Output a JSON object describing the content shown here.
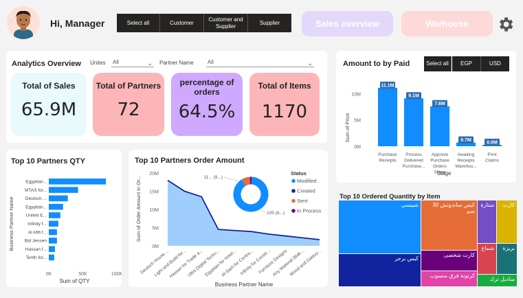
{
  "header": {
    "greeting": "Hi, Manager",
    "segments": [
      "Select all",
      "Customer",
      "Customer and Supplier",
      "Supplier"
    ],
    "nav_sales": "Sales overview",
    "nav_warehouse": "Warhouse"
  },
  "analytics": {
    "title": "Analytics Overview",
    "unites_label": "Unites",
    "unites_value": "All",
    "partner_label": "Partner Name",
    "partner_value": "All",
    "kpis": [
      {
        "label": "Total of Sales",
        "value": "65.9M",
        "color": "#e8fafb"
      },
      {
        "label": "Total of Partners",
        "value": "72",
        "color": "#fdb6b8"
      },
      {
        "label": "percentage of orders",
        "value": "64.5%",
        "color": "#cfa9ff"
      },
      {
        "label": "Total of Items",
        "value": "1170",
        "color": "#fdb6b8"
      }
    ]
  },
  "paid": {
    "title": "Amount to by Paid",
    "buttons": [
      "Select all",
      "EGP",
      "USD"
    ],
    "chart_data": {
      "type": "bar",
      "categories": [
        "Purchase Receipts",
        "Process Delivered Purchase...",
        "Approve Purchase Orders Stage",
        "Awaiting Receipts Warehou...",
        "Print Claims"
      ],
      "values": [
        11.1,
        9.1,
        7.6,
        0.7,
        0.0
      ],
      "data_labels": [
        "11.1M",
        "9.1M",
        "7.6M",
        "0.7M",
        "0.0M"
      ],
      "ylabel": "Sum of Price",
      "xlabel": "Stage",
      "yticks": [
        "0M",
        "5M",
        "10M"
      ],
      "ylim": [
        0,
        12
      ],
      "colors": [
        "#118dff",
        "#118dff",
        "#118dff",
        "#118dff",
        "#2b8fa3"
      ]
    }
  },
  "qty": {
    "title": "Top 10 Partners QTY",
    "chart_data": {
      "type": "bar",
      "orientation": "horizontal",
      "categories": [
        "Egyptian...",
        "MTAS for...",
        "Deutsch ...",
        "Egyptian...",
        "United E...",
        "Infinity f...",
        "Al Afifi f...",
        "Bid Jensen",
        "Hassan f...",
        "Tenth for..."
      ],
      "values": [
        84000,
        43000,
        28000,
        21000,
        17000,
        14000,
        12000,
        12000,
        9000,
        8000
      ],
      "ylabel": "Business Partner Name",
      "xlabel": "Sum of QTY",
      "xticks": [
        "0K",
        "50K",
        "100K"
      ],
      "xlim": [
        0,
        100000
      ]
    }
  },
  "amount": {
    "title": "Top 10 Partners Order Amount",
    "chart_data": {
      "type": "area",
      "categories": [
        "Deutsch House ...",
        "Light and Build for...",
        "Hassan for Trade a...",
        "Ultra Digital Techn...",
        "Egyptian for Hotel...",
        "Al-Sarh for Contra...",
        "Infinity for Constr...",
        "Furniture Designs",
        "Any Material (Bak...",
        "Wood and Galaxy..."
      ],
      "values": [
        18,
        15,
        13.5,
        4.5,
        4.2,
        3.9,
        3.2,
        2.7,
        2.2,
        1.7
      ],
      "ylabel": "Sum of Order Amount in Or...",
      "xlabel": "Business Partner Name",
      "yticks": [
        "0M",
        "5M",
        "10M",
        "15M",
        "20M"
      ],
      "ylim": [
        0,
        20
      ]
    },
    "donut": {
      "legend_title": "Status",
      "labels_text": [
        "11... (9...)",
        "105 (8...)"
      ],
      "slices": [
        {
          "name": "Modified",
          "value": 105,
          "color": "#118dff"
        },
        {
          "name": "Created",
          "value": 0,
          "color": "#12239e"
        },
        {
          "name": "Sent",
          "value": 9,
          "color": "#e66c37"
        },
        {
          "name": "In Process",
          "value": 2,
          "color": "#6b007b"
        }
      ]
    }
  },
  "treemap": {
    "title": "Top 10 Ordered Quantity by Item",
    "cells": [
      {
        "label": "شيبسى",
        "color": "#118dff"
      },
      {
        "label": "كيس برجر",
        "color": "#12239e"
      },
      {
        "label": "كيس ساندوتش 30 سم",
        "color": "#e66c37"
      },
      {
        "label": "كارت شخصى",
        "color": "#6b007b"
      },
      {
        "label": "كرتونة فرق منسوب",
        "color": "#e044a7"
      },
      {
        "label": "ستارة",
        "color": "#744ec2"
      },
      {
        "label": "كارت",
        "color": "#d9b300"
      },
      {
        "label": "شماع",
        "color": "#d64550"
      },
      {
        "label": "بريزة",
        "color": "#197278"
      },
      {
        "label": "مناديل ترك",
        "color": "#1aab40"
      }
    ]
  }
}
